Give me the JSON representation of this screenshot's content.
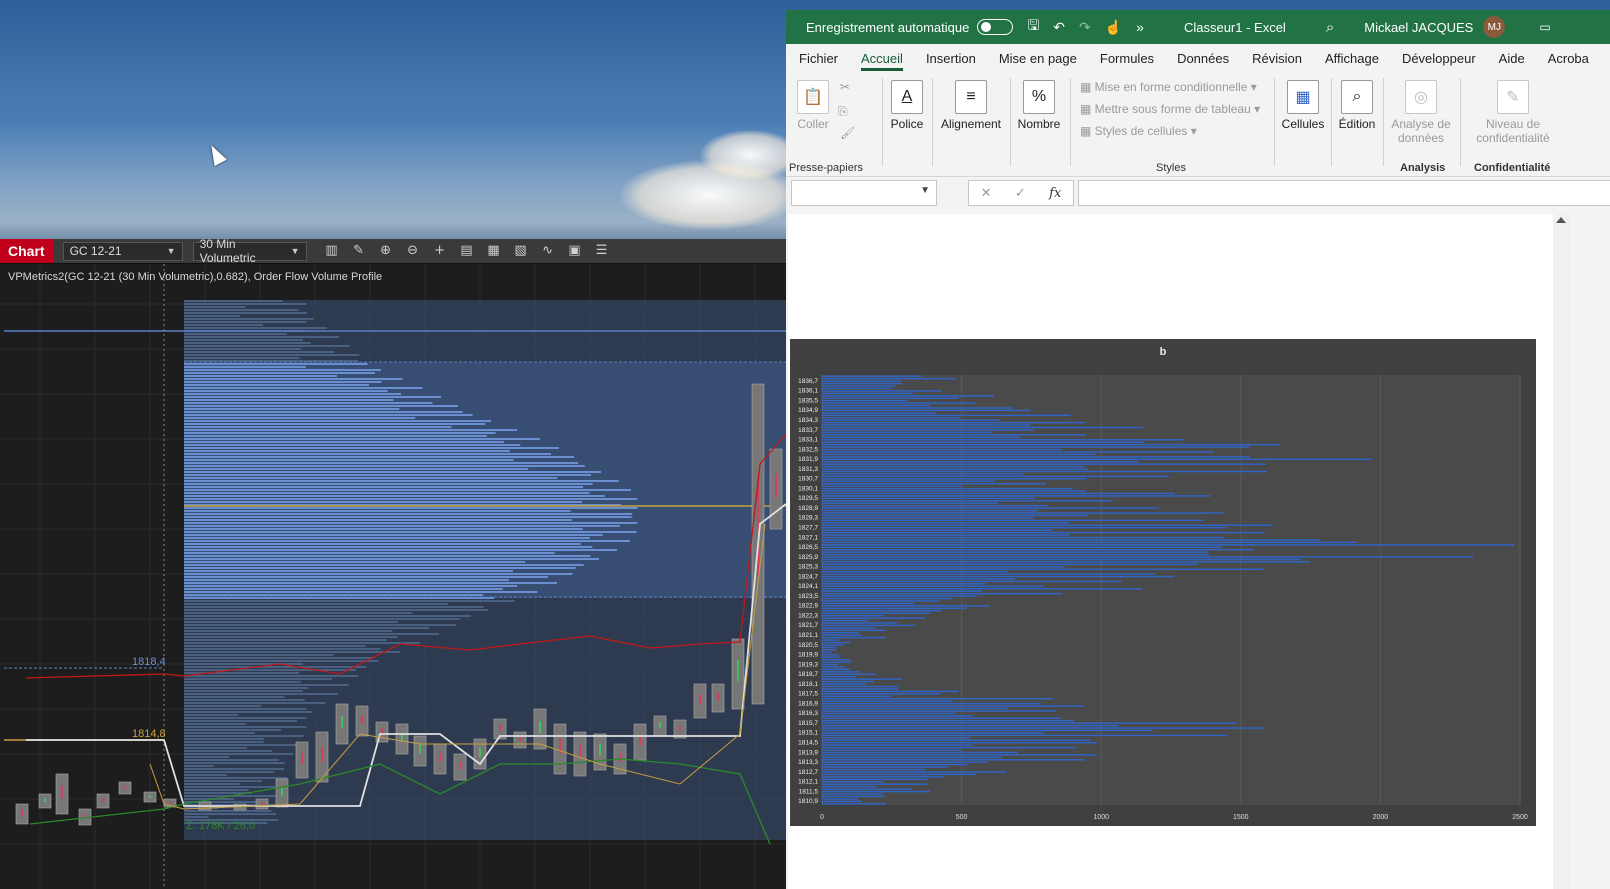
{
  "ninjatrader": {
    "tab_label": "Chart",
    "instrument": "GC 12-21",
    "period": "30 Min Volumetric",
    "caption": "VPMetrics2(GC 12-21 (30 Min Volumetric),0.682), Order Flow Volume Profile",
    "price_tags": [
      "1818,4",
      "1814,8"
    ],
    "stat_text": "Σ: 178K / 26,0",
    "colors": {
      "tab": "#c0001a",
      "profile": "#6a8fd0",
      "value_area": "#4a6aa0",
      "poc": "#c8a040"
    }
  },
  "excel": {
    "autosave_label": "Enregistrement automatique",
    "doc_title": "Classeur1  -  Excel",
    "user_name": "Mickael JACQUES",
    "user_initials": "MJ",
    "tabs": [
      "Fichier",
      "Accueil",
      "Insertion",
      "Mise en page",
      "Formules",
      "Données",
      "Révision",
      "Affichage",
      "Développeur",
      "Aide",
      "Acroba"
    ],
    "ribbon": {
      "coller": "Coller",
      "presse_papiers": "Presse-papiers",
      "police": "Police",
      "alignement": "Alignement",
      "nombre": "Nombre",
      "mise_en_forme_cond": "Mise en forme conditionnelle",
      "mettre_tableau": "Mettre sous forme de tableau",
      "styles_cellules": "Styles de cellules",
      "styles": "Styles",
      "cellules": "Cellules",
      "edition": "Édition",
      "analyse_1": "Analyse de",
      "analyse_2": "données",
      "analysis": "Analysis",
      "niveau_1": "Niveau de",
      "niveau_2": "confidentialité",
      "confidentialite": "Confidentialité"
    },
    "formula_bar": {
      "fx": "fx",
      "cancel": "✕",
      "enter": "✓"
    },
    "chart_data": {
      "type": "bar",
      "orientation": "horizontal",
      "title": "b",
      "categories": [
        "1836,7",
        "1836,1",
        "1835,5",
        "1834,9",
        "1834,3",
        "1833,7",
        "1833,1",
        "1832,5",
        "1831,9",
        "1831,3",
        "1830,7",
        "1830,1",
        "1829,5",
        "1828,9",
        "1828,3",
        "1827,7",
        "1827,1",
        "1826,5",
        "1825,9",
        "1825,3",
        "1824,7",
        "1824,1",
        "1823,5",
        "1822,9",
        "1822,3",
        "1821,7",
        "1821,1",
        "1820,5",
        "1819,9",
        "1819,3",
        "1818,7",
        "1818,1",
        "1817,5",
        "1816,9",
        "1816,3",
        "1815,7",
        "1815,1",
        "1814,5",
        "1813,9",
        "1813,3",
        "1812,7",
        "1812,1",
        "1811,5",
        "1810,9"
      ],
      "values": [
        420,
        380,
        550,
        700,
        820,
        1000,
        1200,
        1550,
        1750,
        1400,
        1100,
        900,
        1300,
        1050,
        1250,
        1500,
        1600,
        2200,
        2050,
        1550,
        1200,
        1000,
        750,
        550,
        400,
        300,
        200,
        90,
        60,
        100,
        170,
        250,
        450,
        850,
        750,
        1300,
        1400,
        950,
        860,
        820,
        600,
        400,
        350,
        200
      ],
      "xlim": [
        0,
        2500
      ],
      "xticks": [
        "0",
        "500",
        "1000",
        "1500",
        "2000",
        "2500"
      ],
      "color": "#2f65c8"
    }
  }
}
